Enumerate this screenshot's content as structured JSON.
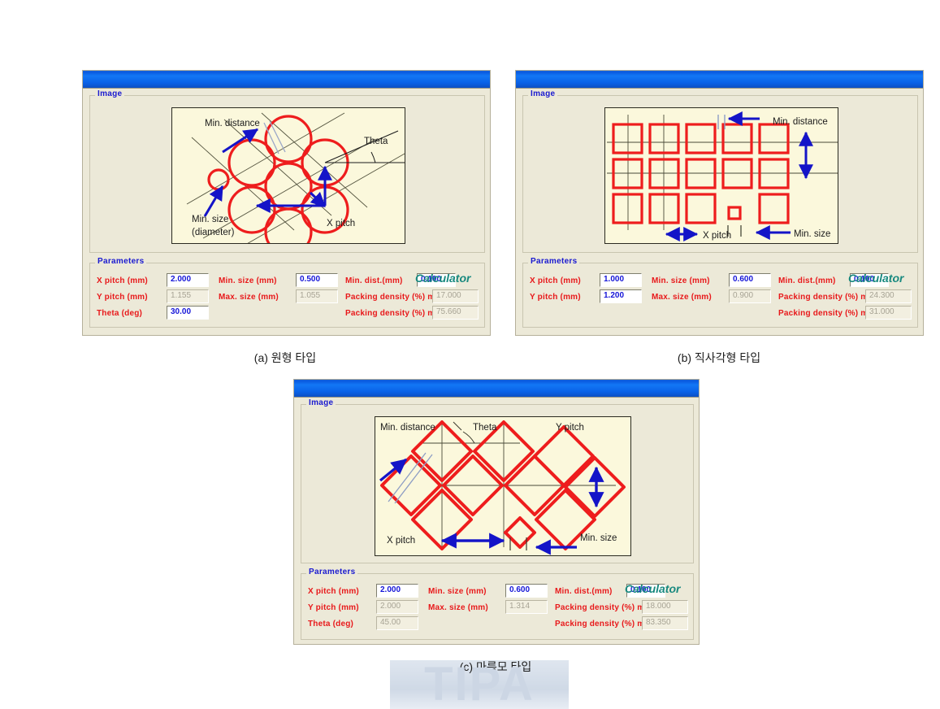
{
  "figure": {
    "watermark": "TIPA"
  },
  "panels": [
    {
      "id": "circle",
      "caption": "(a) 원형 타입",
      "image_group_label": "Image",
      "parameters_group_label": "Parameters",
      "calculator_label": "Calculator",
      "diagram": {
        "labels": {
          "min_distance": "Min. distance",
          "theta": "Theta",
          "min_size": "Min. size",
          "min_size_sub": "(diameter)",
          "x_pitch": "X pitch"
        }
      },
      "fields": [
        {
          "label": "X pitch (mm)",
          "value": "2.000",
          "editable": true
        },
        {
          "label": "Y pitch (mm)",
          "value": "1.155",
          "editable": false
        },
        {
          "label": "Theta (deg)",
          "value": "30.00",
          "editable": true
        },
        {
          "label": "Min. size (mm)",
          "value": "0.500",
          "editable": true
        },
        {
          "label": "Max. size (mm)",
          "value": "1.055",
          "editable": false
        },
        {
          "label": "Min. dist.(mm)",
          "value": "0.100",
          "editable": true
        },
        {
          "label": "Packing density (%) min",
          "value": "17.000",
          "editable": false
        },
        {
          "label": "Packing density (%) max",
          "value": "75.660",
          "editable": false
        }
      ]
    },
    {
      "id": "rectangle",
      "caption": "(b) 직사각형 타입",
      "image_group_label": "Image",
      "parameters_group_label": "Parameters",
      "calculator_label": "Calculator",
      "diagram": {
        "labels": {
          "min_distance": "Min. distance",
          "x_pitch": "X pitch",
          "min_size": "Min. size"
        }
      },
      "fields": [
        {
          "label": "X pitch (mm)",
          "value": "1.000",
          "editable": true
        },
        {
          "label": "Y pitch (mm)",
          "value": "1.200",
          "editable": true
        },
        {
          "label": "Min. size (mm)",
          "value": "0.600",
          "editable": true
        },
        {
          "label": "Max. size (mm)",
          "value": "0.900",
          "editable": false
        },
        {
          "label": "Min. dist.(mm)",
          "value": "0.100",
          "editable": true
        },
        {
          "label": "Packing density (%) min",
          "value": "24.300",
          "editable": false
        },
        {
          "label": "Packing density (%) max",
          "value": "31.000",
          "editable": false
        }
      ]
    },
    {
      "id": "rhombus",
      "caption": "(c) 마름모 타입",
      "image_group_label": "Image",
      "parameters_group_label": "Parameters",
      "calculator_label": "Calculator",
      "diagram": {
        "labels": {
          "min_distance": "Min. distance",
          "theta": "Theta",
          "y_pitch": "Y pitch",
          "x_pitch": "X pitch",
          "min_size": "Min. size"
        }
      },
      "fields": [
        {
          "label": "X pitch (mm)",
          "value": "2.000",
          "editable": true
        },
        {
          "label": "Y pitch (mm)",
          "value": "2.000",
          "editable": false
        },
        {
          "label": "Theta (deg)",
          "value": "45.00",
          "editable": false
        },
        {
          "label": "Min. size (mm)",
          "value": "0.600",
          "editable": true
        },
        {
          "label": "Max. size (mm)",
          "value": "1.314",
          "editable": false
        },
        {
          "label": "Min. dist.(mm)",
          "value": "0.100",
          "editable": true
        },
        {
          "label": "Packing density (%) min",
          "value": "18.000",
          "editable": false
        },
        {
          "label": "Packing density (%) max",
          "value": "83.350",
          "editable": false
        }
      ]
    }
  ]
}
